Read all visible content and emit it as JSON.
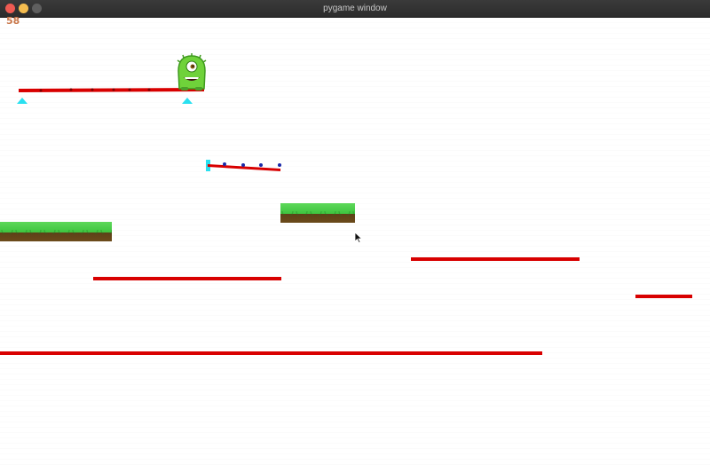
{
  "window": {
    "title": "pygame window"
  },
  "hud": {
    "fps": "58"
  },
  "colors": {
    "platform_red": "#d80000",
    "grass": "#3dc43e",
    "dirt": "#6b4a1a",
    "cyan": "#29e0f0",
    "monster": "#6fd23a"
  },
  "icons": {
    "close": "close-icon",
    "minimize": "minimize-icon",
    "maximize": "maximize-icon",
    "player": "monster-icon",
    "cursor": "cursor-icon"
  }
}
